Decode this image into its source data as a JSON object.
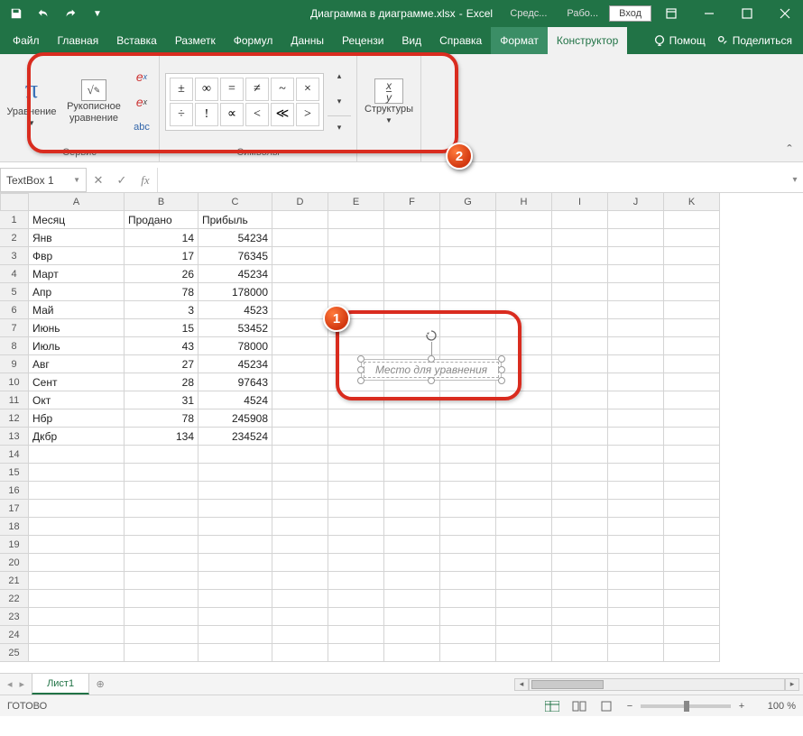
{
  "title": {
    "filename": "Диаграмма в диаграмме.xlsx",
    "app": "Excel"
  },
  "titlebar_right": {
    "tools": "Средс...",
    "work": "Рабо...",
    "signin": "Вход"
  },
  "tabs": {
    "file": "Файл",
    "home": "Главная",
    "insert": "Вставка",
    "layout": "Разметк",
    "formulas": "Формул",
    "data": "Данны",
    "review": "Рецензи",
    "view": "Вид",
    "help": "Справка",
    "format": "Формат",
    "design": "Конструктор"
  },
  "ribbon_right": {
    "help": "Помощ",
    "share": "Поделиться"
  },
  "ribbon_groups": {
    "tools": {
      "label": "Сервис",
      "equation": "Уравнение",
      "ink": "Рукописное уравнение"
    },
    "symbols": {
      "label": "Символы",
      "row1": [
        "±",
        "∞",
        "=",
        "≠",
        "~",
        "×"
      ],
      "row2": [
        "÷",
        "!",
        "∝",
        "<",
        "≪",
        ">"
      ]
    },
    "structures": {
      "label": "Структуры"
    }
  },
  "namebox": "TextBox 1",
  "columns": [
    "A",
    "B",
    "C",
    "D",
    "E",
    "F",
    "G",
    "H",
    "I",
    "J",
    "K"
  ],
  "table": {
    "headers": [
      "Месяц",
      "Продано",
      "Прибыль"
    ],
    "rows": [
      [
        "Янв",
        "14",
        "54234"
      ],
      [
        "Фвр",
        "17",
        "76345"
      ],
      [
        "Март",
        "26",
        "45234"
      ],
      [
        "Апр",
        "78",
        "178000"
      ],
      [
        "Май",
        "3",
        "4523"
      ],
      [
        "Июнь",
        "15",
        "53452"
      ],
      [
        "Июль",
        "43",
        "78000"
      ],
      [
        "Авг",
        "27",
        "45234"
      ],
      [
        "Сент",
        "28",
        "97643"
      ],
      [
        "Окт",
        "31",
        "4524"
      ],
      [
        "Нбр",
        "78",
        "245908"
      ],
      [
        "Дкбр",
        "134",
        "234524"
      ]
    ]
  },
  "equation_placeholder": "Место для уравнения",
  "sheet": {
    "active": "Лист1"
  },
  "status": {
    "ready": "ГОТОВО",
    "zoom": "100 %"
  },
  "badges": {
    "one": "1",
    "two": "2"
  }
}
